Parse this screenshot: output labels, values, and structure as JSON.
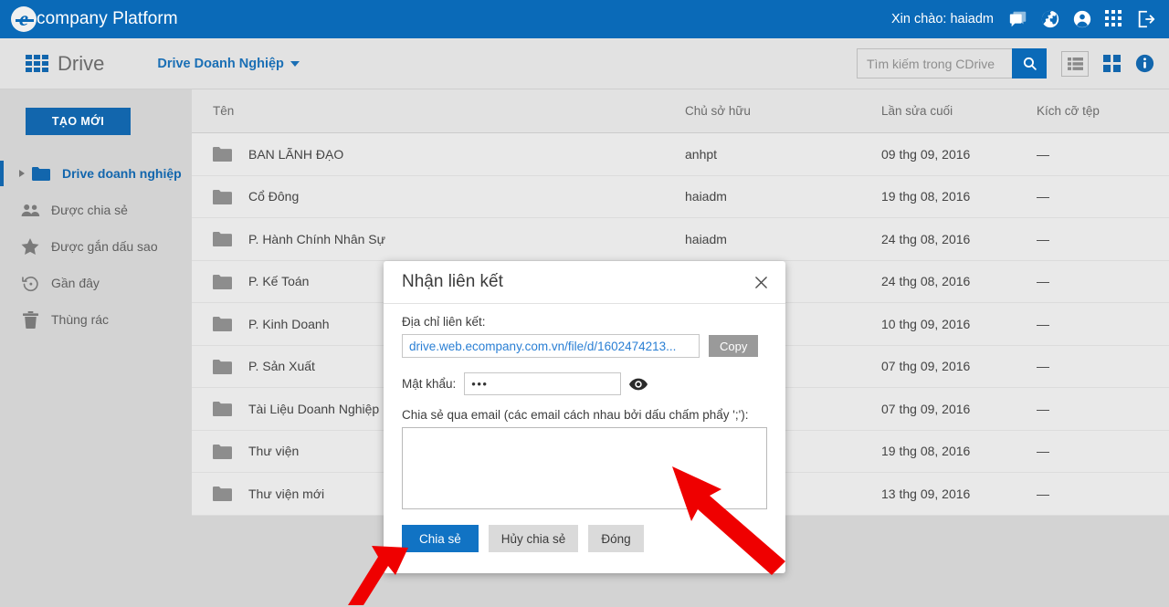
{
  "topbar": {
    "brand_letter": "e",
    "brand_text": "company Platform",
    "greeting": "Xin chào: haiadm",
    "icons": [
      {
        "name": "chat-icon"
      },
      {
        "name": "globe-icon"
      },
      {
        "name": "account-icon"
      },
      {
        "name": "apps-grid-icon"
      },
      {
        "name": "logout-icon"
      }
    ]
  },
  "subbar": {
    "app_name": "Drive",
    "breadcrumb": "Drive Doanh Nghiệp",
    "search": {
      "placeholder": "Tìm kiếm trong CDrive",
      "value": ""
    },
    "view_list_icon": "list-view-icon",
    "view_grid_icon": "grid-view-icon",
    "info_icon": "info-icon"
  },
  "sidebar": {
    "new_button": "TẠO MỚI",
    "items": [
      {
        "label": "Drive doanh nghiệp",
        "icon": "folder-icon",
        "active": true
      },
      {
        "label": "Được chia sẻ",
        "icon": "people-icon",
        "active": false
      },
      {
        "label": "Được gắn dấu sao",
        "icon": "star-icon",
        "active": false
      },
      {
        "label": "Gần đây",
        "icon": "recent-clock-icon",
        "active": false
      },
      {
        "label": "Thùng rác",
        "icon": "trash-icon",
        "active": false
      }
    ]
  },
  "table": {
    "columns": [
      "Tên",
      "Chủ sở hữu",
      "Lần sửa cuối",
      "Kích cỡ tệp"
    ],
    "rows": [
      {
        "name": "BAN LÃNH ĐẠO",
        "owner": "anhpt",
        "modified": "09 thg 09, 2016",
        "size": "—"
      },
      {
        "name": "Cổ Đông",
        "owner": "haiadm",
        "modified": "19 thg 08, 2016",
        "size": "—"
      },
      {
        "name": "P. Hành Chính Nhân Sự",
        "owner": "haiadm",
        "modified": "24 thg 08, 2016",
        "size": "—"
      },
      {
        "name": "P. Kế Toán",
        "owner": "",
        "modified": "24 thg 08, 2016",
        "size": "—"
      },
      {
        "name": "P. Kinh Doanh",
        "owner": "",
        "modified": "10 thg 09, 2016",
        "size": "—"
      },
      {
        "name": "P. Sản Xuất",
        "owner": "",
        "modified": "07 thg 09, 2016",
        "size": "—"
      },
      {
        "name": "Tài Liệu Doanh Nghiệp",
        "owner": "",
        "modified": "07 thg 09, 2016",
        "size": "—"
      },
      {
        "name": "Thư viện",
        "owner": "",
        "modified": "19 thg 08, 2016",
        "size": "—"
      },
      {
        "name": "Thư viện mới",
        "owner": "",
        "modified": "13 thg 09, 2016",
        "size": "—"
      }
    ]
  },
  "modal": {
    "title": "Nhận liên kết",
    "close_icon": "close-icon",
    "link_label": "Địa chỉ liên kết:",
    "link_value": "drive.web.ecompany.com.vn/file/d/1602474213...",
    "copy_button": "Copy",
    "password_label": "Mật khẩu:",
    "password_value": "•••",
    "eye_icon": "eye-icon",
    "email_label": "Chia sẻ qua email (các email cách nhau bởi dấu chấm phẩy ';'):",
    "email_value": "",
    "share_button": "Chia sẻ",
    "unshare_button": "Hủy chia sẻ",
    "close_button": "Đóng"
  },
  "colors": {
    "header_blue": "#0a6ab8",
    "accent_blue": "#1266ad",
    "link_blue": "#2a7fd4",
    "annotation_red": "#ef0000",
    "page_bg": "#d3d3d3",
    "row_bg": "#e9e9e9"
  }
}
